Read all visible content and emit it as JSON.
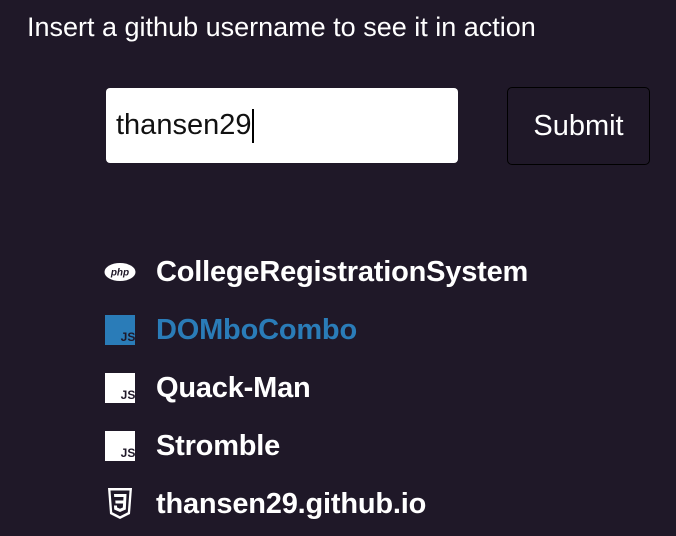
{
  "header": {
    "prompt": "Insert a github username to see it in action"
  },
  "form": {
    "username_value": "thansen29",
    "submit_label": "Submit"
  },
  "repos": [
    {
      "name": "CollegeRegistrationSystem",
      "language_icon": "php-icon",
      "icon_text": "php",
      "active": false
    },
    {
      "name": "DOMboCombo",
      "language_icon": "javascript-icon",
      "icon_text": "JS",
      "active": true
    },
    {
      "name": "Quack-Man",
      "language_icon": "javascript-icon",
      "icon_text": "JS",
      "active": false
    },
    {
      "name": "Stromble",
      "language_icon": "javascript-icon",
      "icon_text": "JS",
      "active": false
    },
    {
      "name": "thansen29.github.io",
      "language_icon": "css3-icon",
      "icon_text": "3",
      "active": false
    }
  ],
  "colors": {
    "background": "#1f1828",
    "text": "#ffffff",
    "active_link": "#2a7cb8"
  }
}
